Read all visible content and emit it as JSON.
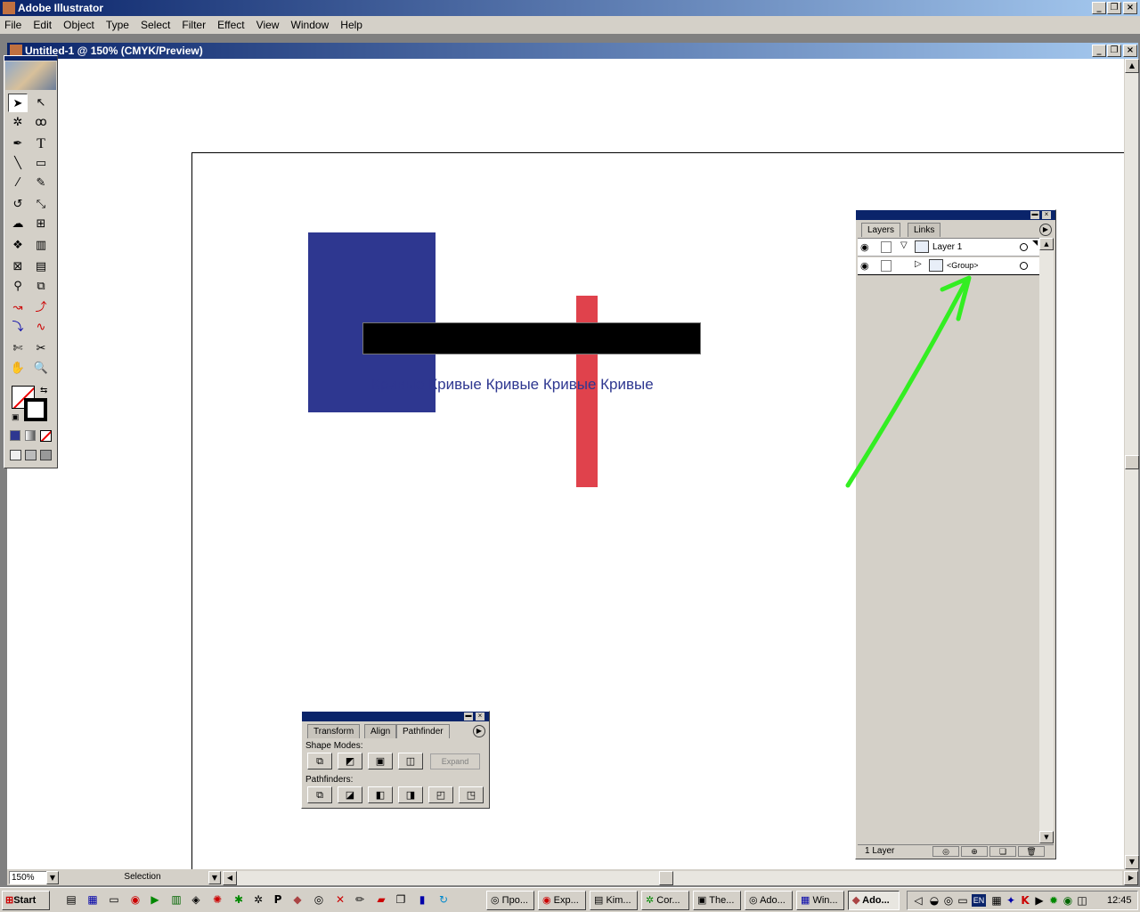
{
  "app": {
    "title": "Adobe Illustrator"
  },
  "menu": [
    "File",
    "Edit",
    "Object",
    "Type",
    "Select",
    "Filter",
    "Effect",
    "View",
    "Window",
    "Help"
  ],
  "document": {
    "title": "Untitled-1 @ 150% (CMYK/Preview)"
  },
  "artwork": {
    "text": "Кривые Кривые Кривые Кривые Кривые",
    "colors": {
      "blue": "#2e3790",
      "red": "#e0424c",
      "black": "#000000",
      "text": "#2e3790"
    }
  },
  "tools": [
    "selection-arrow",
    "direct-select",
    "magic-wand",
    "lasso",
    "pen",
    "type",
    "line",
    "rectangle",
    "paintbrush",
    "pencil",
    "rotate",
    "scale",
    "warp",
    "free-transform",
    "symbol-sprayer",
    "column-graph",
    "mesh",
    "gradient",
    "eyedropper",
    "blend",
    "slice",
    "scissors",
    "hand",
    "zoom"
  ],
  "layers_palette": {
    "tabs": [
      "Layers",
      "Links"
    ],
    "rows": [
      {
        "name": "Layer 1"
      },
      {
        "name": "<Group>"
      }
    ],
    "footer": "1 Layer"
  },
  "pathfinder_palette": {
    "tabs": [
      "Transform",
      "Align",
      "Pathfinder"
    ],
    "shape_modes_label": "Shape Modes:",
    "expand_label": "Expand",
    "pathfinders_label": "Pathfinders:"
  },
  "statusbar": {
    "zoom": "150%",
    "mode": "Selection"
  },
  "taskbar": {
    "start": "Start",
    "buttons": [
      "Про...",
      "Exp...",
      "Kim...",
      "Cor...",
      "The...",
      "Ado...",
      "Win...",
      "Ado..."
    ],
    "lang": "EN",
    "clock": "12:45"
  },
  "annotation": {
    "color": "#33ee22"
  }
}
